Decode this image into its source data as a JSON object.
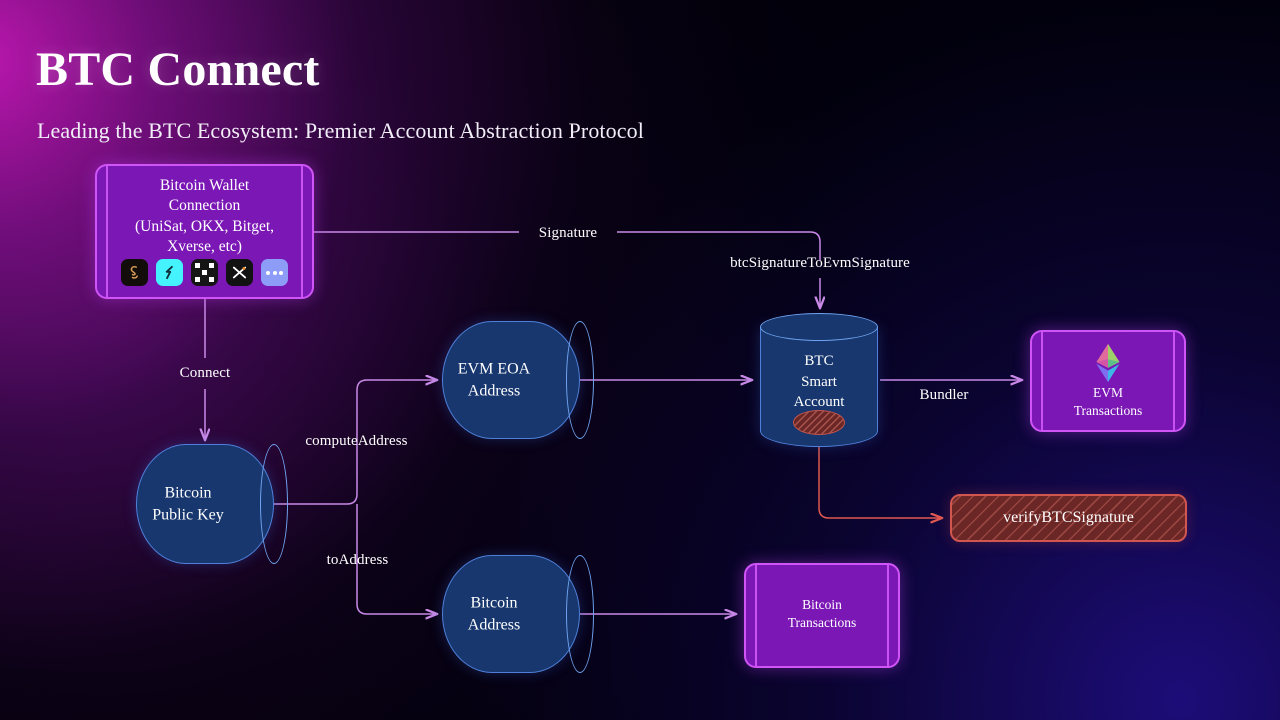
{
  "header": {
    "title": "BTC Connect",
    "subtitle": "Leading the BTC Ecosystem: Premier Account Abstraction Protocol"
  },
  "nodes": {
    "wallet": {
      "label": "Bitcoin Wallet\nConnection\n(UniSat, OKX, Bitget,\nXverse, etc)",
      "line1": "Bitcoin Wallet",
      "line2": "Connection",
      "line3": "(UniSat, OKX, Bitget,",
      "line4": "Xverse, etc)",
      "icons": [
        "unisat-wallet-icon",
        "bitget-wallet-icon",
        "okx-wallet-icon",
        "xverse-wallet-icon",
        "more-wallets-icon"
      ]
    },
    "bitcoin_public_key": {
      "line1": "Bitcoin",
      "line2": "Public Key"
    },
    "evm_eoa_address": {
      "line1": "EVM EOA",
      "line2": "Address"
    },
    "bitcoin_address": {
      "line1": "Bitcoin",
      "line2": "Address"
    },
    "btc_smart_account": {
      "line1": "BTC",
      "line2": "Smart",
      "line3": "Account"
    },
    "evm_transactions": {
      "line1": "EVM",
      "line2": "Transactions",
      "icon": "ethereum-logo-icon"
    },
    "bitcoin_transactions": {
      "line1": "Bitcoin",
      "line2": "Transactions"
    },
    "verify_btc_signature": {
      "label": "verifyBTCSignature"
    }
  },
  "edges": {
    "connect": "Connect",
    "signature": "Signature",
    "btc_sig_to_evm_sig": "btcSignatureToEvmSignature",
    "compute_address": "computeAddress",
    "to_address": "toAddress",
    "bundler": "Bundler"
  },
  "colors": {
    "purple_fill": "#7b17b5",
    "purple_border": "#cf55f7",
    "blue_fill": "#17376e",
    "blue_border": "#4f7fd8",
    "red_fill": "#6b2726",
    "red_border": "#d0564f",
    "edge_purple": "#c98ae8",
    "edge_red": "#e0594f",
    "background": "#010007"
  }
}
